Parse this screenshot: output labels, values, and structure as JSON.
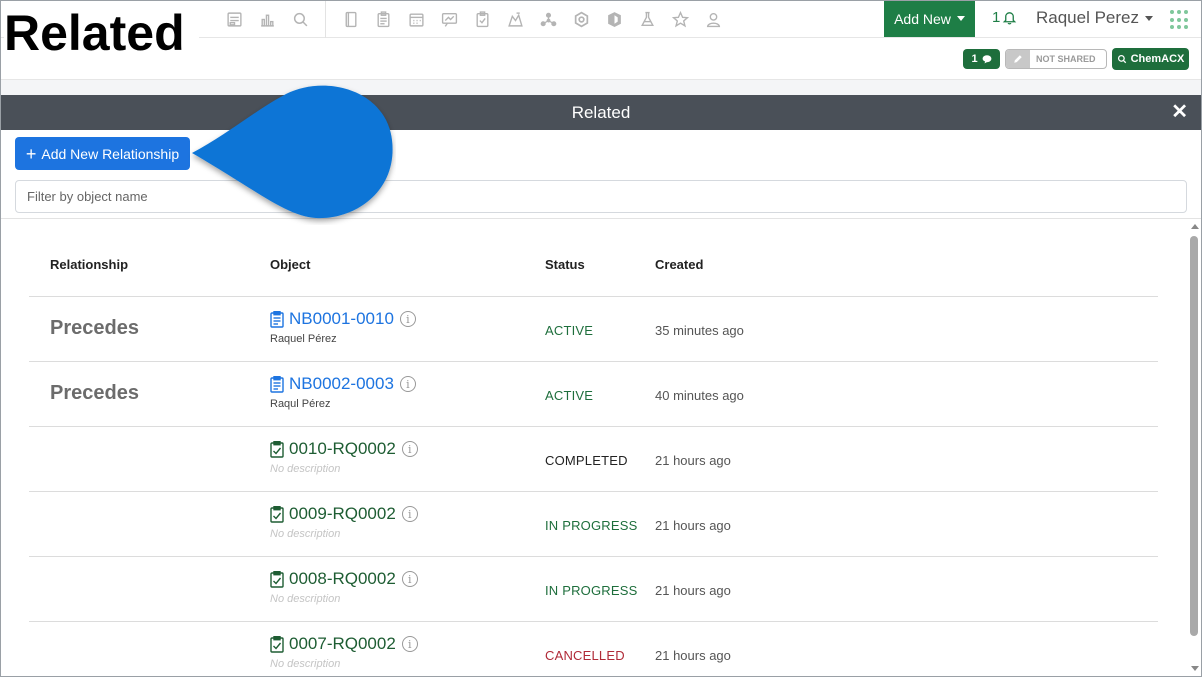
{
  "page": {
    "heading": "Related"
  },
  "header": {
    "add_new_label": "Add New",
    "notification_count": "1",
    "user_name": "Raquel Perez",
    "toolbar_icons": [
      "form-icon",
      "chart-icon",
      "search-icon",
      "notebook-icon",
      "clipboard-icon",
      "calendar-icon",
      "presentation-icon",
      "request-icon",
      "lab-icon",
      "molecule-icon",
      "hexagon-icon",
      "sample-icon",
      "flask-icon",
      "star-icon",
      "users-icon"
    ]
  },
  "subbar": {
    "comment_count": "1",
    "share_status": "NOT SHARED",
    "chemacx_label": "ChemACX"
  },
  "modal": {
    "title": "Related",
    "add_relationship_label": "Add New Relationship",
    "filter_placeholder": "Filter by object name"
  },
  "table": {
    "headers": {
      "relationship": "Relationship",
      "object": "Object",
      "status": "Status",
      "created": "Created"
    },
    "rows": [
      {
        "relationship": "Precedes",
        "object": "NB0001-0010",
        "subtitle": "Raquel Pérez",
        "status": "ACTIVE",
        "created": "35 minutes ago"
      },
      {
        "relationship": "Precedes",
        "object": "NB0002-0003",
        "subtitle": "Raqul Pérez",
        "status": "ACTIVE",
        "created": "40 minutes ago"
      },
      {
        "relationship": "",
        "object": "0010-RQ0002",
        "subtitle": "No description",
        "status": "COMPLETED",
        "created": "21 hours ago"
      },
      {
        "relationship": "",
        "object": "0009-RQ0002",
        "subtitle": "No description",
        "status": "IN PROGRESS",
        "created": "21 hours ago"
      },
      {
        "relationship": "",
        "object": "0008-RQ0002",
        "subtitle": "No description",
        "status": "IN PROGRESS",
        "created": "21 hours ago"
      },
      {
        "relationship": "",
        "object": "0007-RQ0002",
        "subtitle": "No description",
        "status": "CANCELLED",
        "created": "21 hours ago"
      }
    ]
  },
  "colors": {
    "brand_green": "#1e7e46",
    "primary_blue": "#1d74e0",
    "modal_header": "#4a5058",
    "status_active": "#1e6e3c",
    "status_completed": "#222222",
    "status_in_progress": "#1e6e3c",
    "status_cancelled": "#b02a37",
    "callout": "#0a74d6"
  }
}
